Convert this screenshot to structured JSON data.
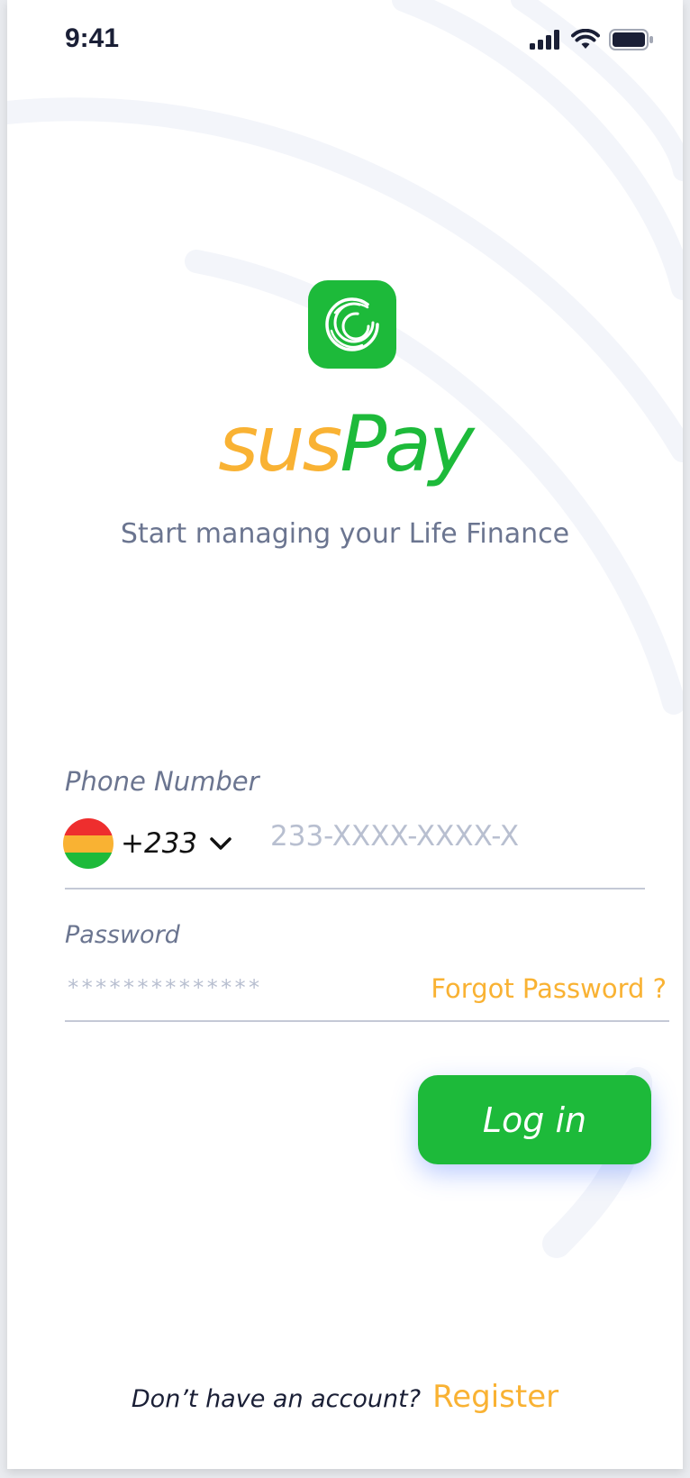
{
  "status_bar": {
    "time": "9:41",
    "signal_icon": "cellular-signal-icon",
    "wifi_icon": "wifi-icon",
    "battery_icon": "battery-icon"
  },
  "brand": {
    "logo_icon": "suspay-logo-icon",
    "name_part1": "sus",
    "name_part2": "Pay",
    "tagline": "Start managing your Life Finance"
  },
  "form": {
    "phone_label": "Phone Number",
    "country_flag_icon": "ghana-flag-icon",
    "country_code": "+233",
    "phone_value": "",
    "phone_placeholder": "233-XXXX-XXXX-X",
    "password_label": "Password",
    "password_value": "",
    "password_placeholder": "**************",
    "forgot_password": "Forgot Password ?",
    "login_label": "Log in"
  },
  "footer": {
    "prompt": "Don’t have an account?",
    "register_label": "Register"
  },
  "colors": {
    "brand_green": "#1dba3a",
    "brand_orange": "#f9b233",
    "text_muted": "#6b7590",
    "text_dark": "#1a1f36"
  }
}
